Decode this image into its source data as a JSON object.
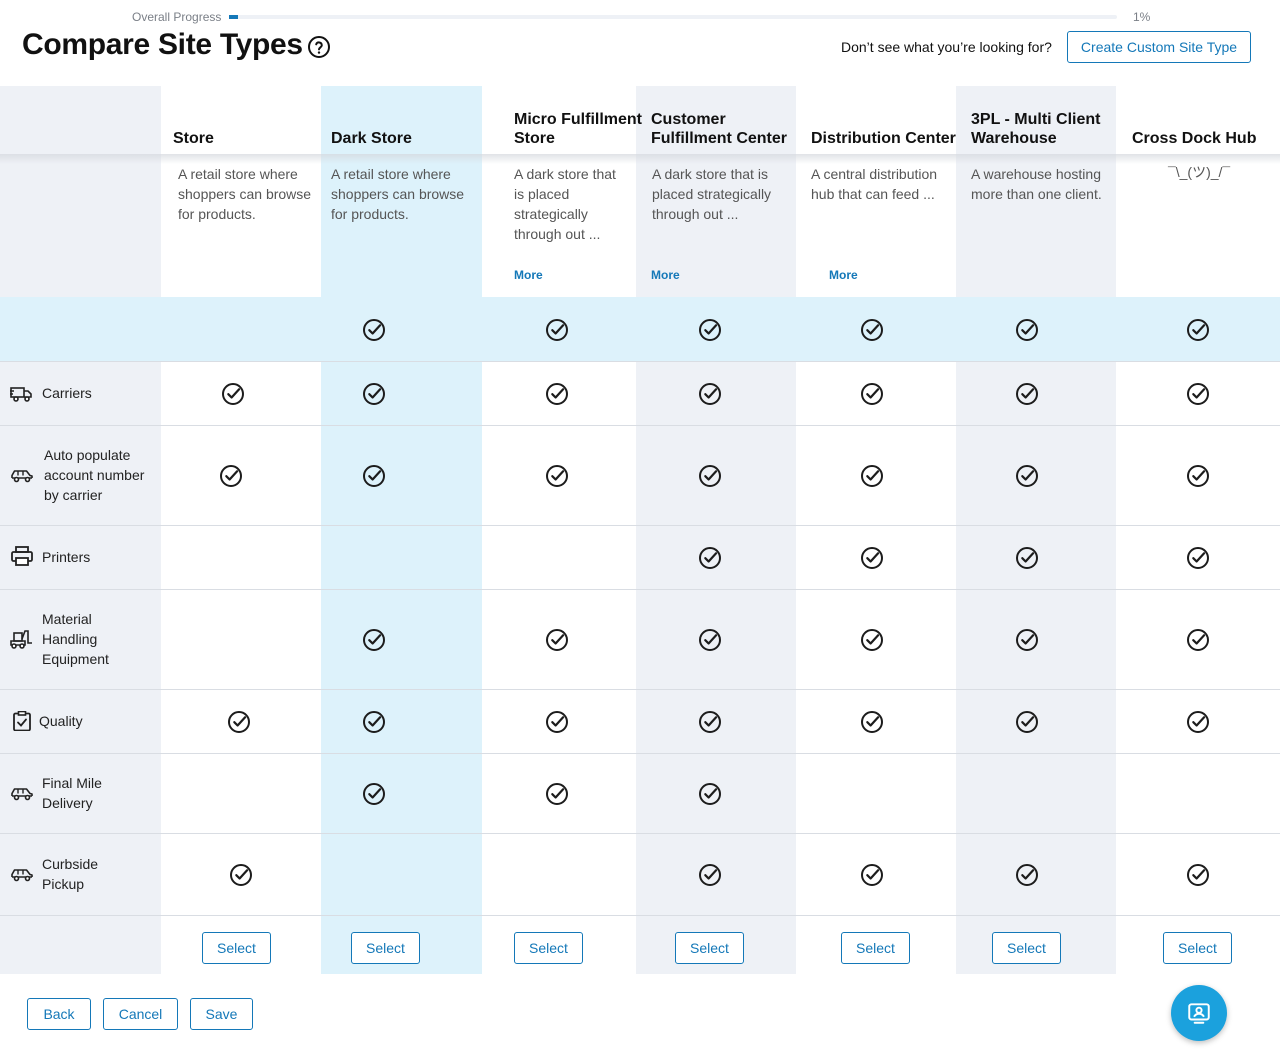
{
  "progress": {
    "label": "Overall Progress",
    "value_text": "1%",
    "value": 0.01
  },
  "header": {
    "title": "Compare Site Types",
    "help_text": "Don’t see what you’re looking for?",
    "create_button": "Create Custom Site Type"
  },
  "columns": [
    {
      "title": "Store",
      "description": "A retail store where shoppers can browse for products.",
      "more": ""
    },
    {
      "title": "Dark Store",
      "description": "A retail store where shoppers can browse for products.",
      "more": ""
    },
    {
      "title": "Micro Fulfillment Store",
      "description": "A dark store that is placed strategically through out ...",
      "more": "More"
    },
    {
      "title": "Customer Fulfillment Center",
      "description": "A dark store that is placed strategically through out ...",
      "more": "More"
    },
    {
      "title": "Distribution Center",
      "description": "A central distribution hub that can feed ...",
      "more": "More"
    },
    {
      "title": "3PL - Multi Client Warehouse",
      "description": "A warehouse hosting more than one client.",
      "more": ""
    },
    {
      "title": "Cross Dock Hub",
      "description": "¯\\_(ツ)_/¯",
      "more": ""
    }
  ],
  "band_row": {
    "checks": [
      false,
      true,
      true,
      true,
      true,
      true,
      true
    ]
  },
  "features": [
    {
      "label": "Carriers",
      "icon": "truck-icon",
      "checks": [
        true,
        true,
        true,
        true,
        true,
        true,
        true
      ]
    },
    {
      "label": "Auto populate account number by carrier",
      "icon": "car-icon",
      "checks": [
        true,
        true,
        true,
        true,
        true,
        true,
        true
      ]
    },
    {
      "label": "Printers",
      "icon": "printer-icon",
      "checks": [
        false,
        false,
        false,
        true,
        true,
        true,
        true
      ]
    },
    {
      "label": "Material Handling Equipment",
      "icon": "forklift-icon",
      "checks": [
        false,
        true,
        true,
        true,
        true,
        true,
        true
      ]
    },
    {
      "label": "Quality",
      "icon": "clipboard-check-icon",
      "checks": [
        true,
        true,
        true,
        true,
        true,
        true,
        true
      ]
    },
    {
      "label": "Final Mile Delivery",
      "icon": "car-icon",
      "checks": [
        false,
        true,
        true,
        true,
        false,
        false,
        false
      ]
    },
    {
      "label": "Curbside Pickup",
      "icon": "car-icon",
      "checks": [
        true,
        false,
        false,
        true,
        true,
        true,
        true
      ]
    }
  ],
  "select_label": "Select",
  "footer": {
    "back": "Back",
    "cancel": "Cancel",
    "save": "Save"
  },
  "fab_icon": "contact-card-icon",
  "colors": {
    "accent": "#1478b8",
    "highlight_column": "#ddf2fb",
    "shaded_column": "#eef1f6",
    "fab": "#1ba1dd"
  }
}
